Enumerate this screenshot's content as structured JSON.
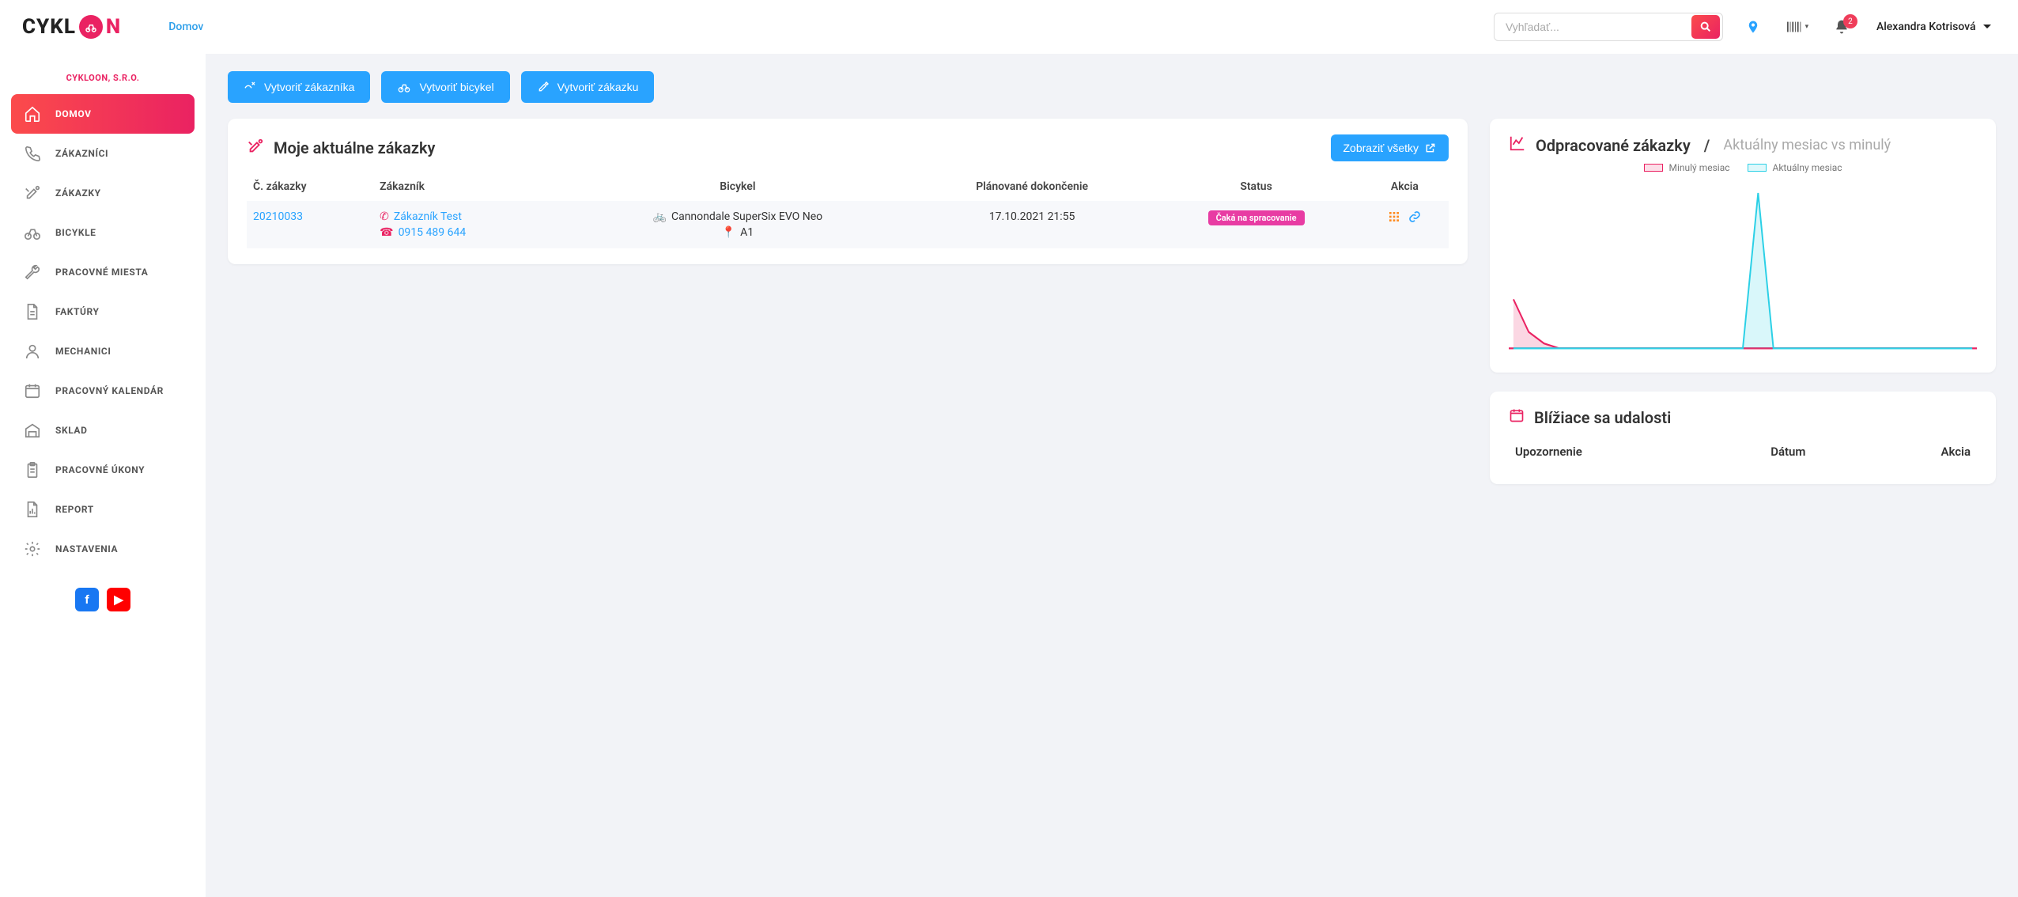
{
  "brand": {
    "part1": "CYKL",
    "part2": "N"
  },
  "breadcrumb": "Domov",
  "search": {
    "placeholder": "Vyhľadať..."
  },
  "notifications_count": "2",
  "user_name": "Alexandra Kotrisová",
  "company_name": "CYKLOON, S.R.O.",
  "sidebar": [
    {
      "label": "DOMOV",
      "icon": "home",
      "active": true
    },
    {
      "label": "ZÁKAZNÍCI",
      "icon": "phone"
    },
    {
      "label": "ZÁKAZKY",
      "icon": "tools"
    },
    {
      "label": "BICYKLE",
      "icon": "bike"
    },
    {
      "label": "PRACOVNÉ MIESTA",
      "icon": "wrench"
    },
    {
      "label": "FAKTÚRY",
      "icon": "file"
    },
    {
      "label": "MECHANICI",
      "icon": "user"
    },
    {
      "label": "PRACOVNÝ KALENDÁR",
      "icon": "calendar"
    },
    {
      "label": "SKLAD",
      "icon": "warehouse"
    },
    {
      "label": "PRACOVNÉ ÚKONY",
      "icon": "clipboard"
    },
    {
      "label": "REPORT",
      "icon": "report"
    },
    {
      "label": "NASTAVENIA",
      "icon": "gear"
    }
  ],
  "quick_actions": {
    "create_customer": "Vytvoriť zákazníka",
    "create_bike": "Vytvoriť bicykel",
    "create_order": "Vytvoriť zákazku"
  },
  "orders_card": {
    "title": "Moje aktuálne zákazky",
    "show_all": "Zobraziť všetky",
    "columns": {
      "order_no": "Č. zákazky",
      "customer": "Zákazník",
      "bike": "Bicykel",
      "planned": "Plánované dokončenie",
      "status": "Status",
      "action": "Akcia"
    },
    "rows": [
      {
        "order_no": "20210033",
        "customer_name": "Zákazník Test",
        "customer_phone": "0915 489 644",
        "bike": "Cannondale SuperSix EVO Neo",
        "location": "A1",
        "planned": "17.10.2021 21:55",
        "status": "Čaká na spracovanie"
      }
    ]
  },
  "worked_card": {
    "title": "Odpracované zákazky",
    "subtitle": "Aktuálny mesiac vs minulý",
    "legend_prev": "Minulý mesiac",
    "legend_cur": "Aktuálny mesiac"
  },
  "events_card": {
    "title": "Blížiace sa udalosti",
    "columns": {
      "notice": "Upozornenie",
      "date": "Dátum",
      "action": "Akcia"
    }
  },
  "chart_data": {
    "type": "area",
    "x": [
      1,
      2,
      3,
      4,
      5,
      6,
      7,
      8,
      9,
      10,
      11,
      12,
      13,
      14,
      15,
      16,
      17,
      18,
      19,
      20,
      21,
      22,
      23,
      24,
      25,
      26,
      27,
      28,
      29,
      30,
      31
    ],
    "series": [
      {
        "name": "Minulý mesiac",
        "color": "#ea2262",
        "values": [
          3,
          1,
          0.3,
          0,
          0,
          0,
          0,
          0,
          0,
          0,
          0,
          0,
          0,
          0,
          0,
          0,
          0,
          0,
          0,
          0,
          0,
          0,
          0,
          0,
          0,
          0,
          0,
          0,
          0,
          0,
          0
        ]
      },
      {
        "name": "Aktuálny mesiac",
        "color": "#2bd0e6",
        "values": [
          0,
          0,
          0,
          0,
          0,
          0,
          0,
          0,
          0,
          0,
          0,
          0,
          0,
          0,
          0,
          0,
          9.5,
          0,
          0,
          0,
          0,
          0,
          0,
          0,
          0,
          0,
          0,
          0,
          0,
          0,
          0
        ]
      }
    ],
    "ylim": [
      0,
      10
    ],
    "xlabel": "",
    "ylabel": ""
  }
}
